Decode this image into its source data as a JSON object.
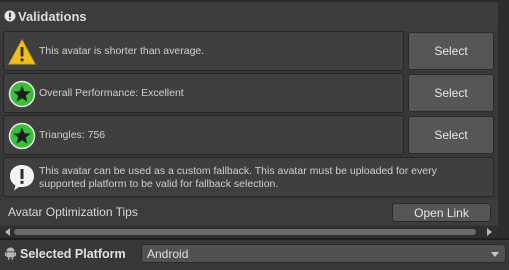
{
  "section": {
    "title": "Validations"
  },
  "validations": [
    {
      "icon": "warning-icon",
      "text": "This avatar is shorter than average.",
      "action": "Select"
    },
    {
      "icon": "star-badge-icon",
      "text": "Overall Performance: Excellent",
      "action": "Select"
    },
    {
      "icon": "star-badge-icon",
      "text": "Triangles: 756",
      "action": "Select"
    }
  ],
  "info": {
    "icon": "info-icon",
    "text": "This avatar can be used as a custom fallback. This avatar must be uploaded for every supported platform to be valid for fallback selection."
  },
  "tips": {
    "label": "Avatar Optimization Tips",
    "button": "Open Link"
  },
  "footer": {
    "label": "Selected Platform",
    "platform_value": "Android"
  },
  "colors": {
    "warning": "#f0c020",
    "success": "#3bbf3b",
    "background": "#383838"
  }
}
